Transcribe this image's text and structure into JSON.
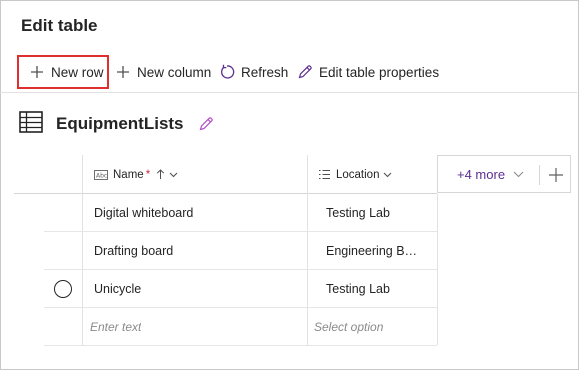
{
  "page": {
    "title": "Edit table"
  },
  "toolbar": {
    "new_row": "New row",
    "new_column": "New column",
    "refresh": "Refresh",
    "edit_properties": "Edit table properties"
  },
  "table": {
    "name": "EquipmentLists",
    "columns": [
      {
        "label": "Name",
        "required": "*",
        "type_icon": "text-type-icon",
        "sort": "ascending"
      },
      {
        "label": "Location",
        "type_icon": "choice-type-icon"
      }
    ],
    "more_columns": "+4 more",
    "rows": [
      {
        "name": "Digital whiteboard",
        "location": "Testing Lab"
      },
      {
        "name": "Drafting board",
        "location": "Engineering B…"
      },
      {
        "name": "Unicycle",
        "location": "Testing Lab",
        "selector": "radio"
      }
    ],
    "new_row_placeholders": {
      "name": "Enter text",
      "location": "Select option"
    }
  },
  "colors": {
    "highlight": "#e02f2f",
    "accent": "#5c2e91",
    "required": "#c4314b"
  }
}
